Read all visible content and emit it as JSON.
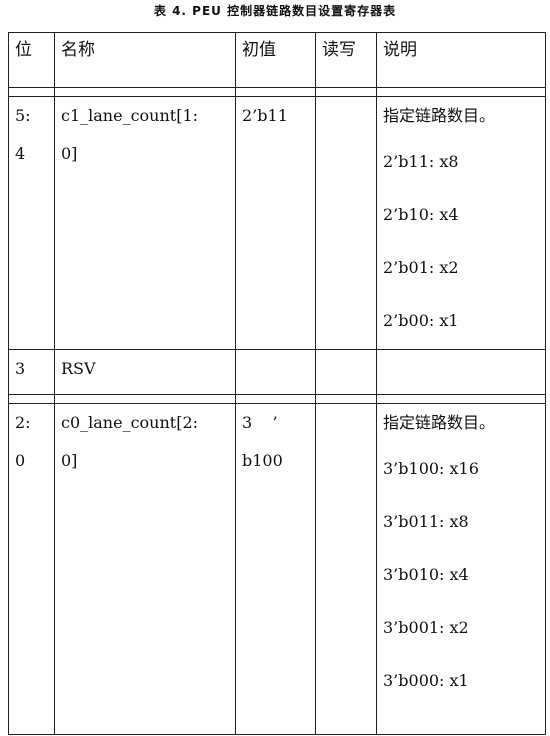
{
  "caption": "表 4. PEU 控制器链路数目设置寄存器表",
  "table": {
    "headers": {
      "bit": "位",
      "name": "名称",
      "init": "初值",
      "rw": "读写",
      "desc": "说明"
    },
    "rows": [
      {
        "bit_line1": "5:",
        "bit_line2": "4",
        "name_line1": "c1_lane_count[1:",
        "name_line2": "0]",
        "init_line1": "2’b11",
        "init_line2": "",
        "rw": "",
        "desc": [
          "指定链路数目。",
          "2’b11: x8",
          "2’b10: x4",
          "2’b01: x2",
          "2’b00: x1"
        ]
      },
      {
        "bit_line1": "3",
        "bit_line2": "",
        "name_line1": "RSV",
        "name_line2": "",
        "init_line1": "",
        "init_line2": "",
        "rw": "",
        "desc": []
      },
      {
        "bit_line1": "2:",
        "bit_line2": "0",
        "name_line1": "c0_lane_count[2:",
        "name_line2": "0]",
        "init_line1": "3    ’",
        "init_line2": "b100",
        "rw": "",
        "desc": [
          "指定链路数目。",
          "3’b100: x16",
          "3’b011: x8",
          "3’b010: x4",
          "3’b001: x2",
          "3’b000: x1"
        ]
      }
    ]
  }
}
